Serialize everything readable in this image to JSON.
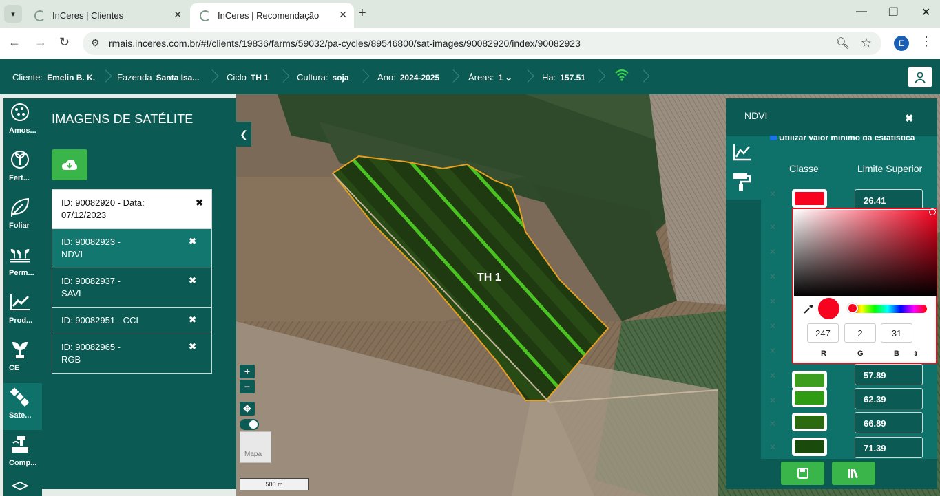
{
  "browser": {
    "tabs": [
      {
        "title": "InCeres | Clientes"
      },
      {
        "title": "InCeres | Recomendação"
      }
    ],
    "url": "rmais.inceres.com.br/#!/clients/19836/farms/59032/pa-cycles/89546800/sat-images/90082920/index/90082923",
    "profile_initial": "E"
  },
  "header": {
    "cliente_label": "Cliente:",
    "cliente_value": "Emelin B. K.",
    "fazenda_label": "Fazenda",
    "fazenda_value": "Santa Isa...",
    "ciclo_label": "Ciclo",
    "ciclo_value": "TH 1",
    "cultura_label": "Cultura:",
    "cultura_value": "soja",
    "ano_label": "Ano:",
    "ano_value": "2024-2025",
    "areas_label": "Áreas:",
    "areas_value": "1",
    "ha_label": "Ha:",
    "ha_value": "157.51"
  },
  "sidebar": {
    "items": [
      {
        "label": "Amos..."
      },
      {
        "label": "Fert..."
      },
      {
        "label": "Foliar"
      },
      {
        "label": "Perm..."
      },
      {
        "label": "Prod..."
      },
      {
        "label": "CE"
      },
      {
        "label": "Sate..."
      },
      {
        "label": "Comp..."
      }
    ]
  },
  "sat_panel": {
    "title": "IMAGENS DE SATÉLITE",
    "header_item": "ID: 90082920 - Data: 07/12/2023",
    "items": [
      {
        "line1": "ID: 90082923 -",
        "line2": "NDVI"
      },
      {
        "line1": "ID: 90082937 -",
        "line2": "SAVI"
      },
      {
        "line1": "ID: 90082951 - CCI",
        "line2": ""
      },
      {
        "line1": "ID: 90082965 -",
        "line2": "RGB"
      }
    ]
  },
  "map": {
    "field_label": "TH 1",
    "zoom_in": "+",
    "zoom_out": "−",
    "minimap_label": "Mapa",
    "scale_label": "500 m"
  },
  "ndvi": {
    "title": "NDVI",
    "checkbox_label": "Utilizar valor mínimo da estatística",
    "col_classe": "Classe",
    "col_limite": "Limite Superior",
    "rows": [
      {
        "color": "#f7021f",
        "limit": "26.41"
      },
      {
        "color": "#3c9e1c",
        "limit": "57.89"
      },
      {
        "color": "#2f9b12",
        "limit": "62.39"
      },
      {
        "color": "#2c6a10",
        "limit": "66.89"
      },
      {
        "color": "#1a4a0c",
        "limit": "71.39"
      }
    ]
  },
  "picker": {
    "color": "#f7021f",
    "r": "247",
    "g": "2",
    "b": "31",
    "r_label": "R",
    "g_label": "G",
    "b_label": "B"
  },
  "colors": {
    "primary": "#0b5a53",
    "accent_green": "#39b54a"
  }
}
